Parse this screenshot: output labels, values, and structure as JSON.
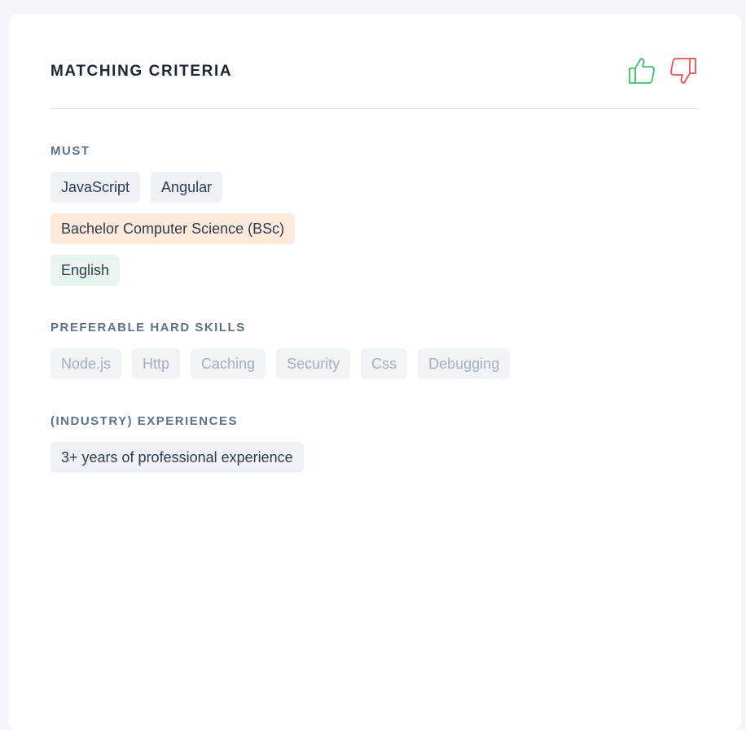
{
  "header": {
    "title": "MATCHING CRITERIA",
    "thumb_up_icon": "thumbs-up-icon",
    "thumb_down_icon": "thumbs-down-icon",
    "thumb_up_color": "#3cc16a",
    "thumb_down_color": "#e85252"
  },
  "must": {
    "label": "MUST",
    "tags": [
      {
        "label": "JavaScript",
        "style": "default"
      },
      {
        "label": "Angular",
        "style": "default"
      },
      {
        "label": "Bachelor Computer Science (BSc)",
        "style": "orange"
      },
      {
        "label": "English",
        "style": "green"
      }
    ]
  },
  "preferable": {
    "label": "PREFERABLE HARD SKILLS",
    "tags": [
      "Node.js",
      "Http",
      "Caching",
      "Security",
      "Css",
      "Debugging"
    ]
  },
  "experiences": {
    "label": "(INDUSTRY) EXPERIENCES",
    "tags": [
      "3+ years of professional experience"
    ]
  },
  "colors": {
    "background": "#f2f5f9",
    "card": "#ffffff",
    "tag_default": "#edf1f5",
    "tag_orange": "#fdeadc",
    "tag_green": "#e8f4ee",
    "tag_muted_text": "#a5b0bc"
  }
}
